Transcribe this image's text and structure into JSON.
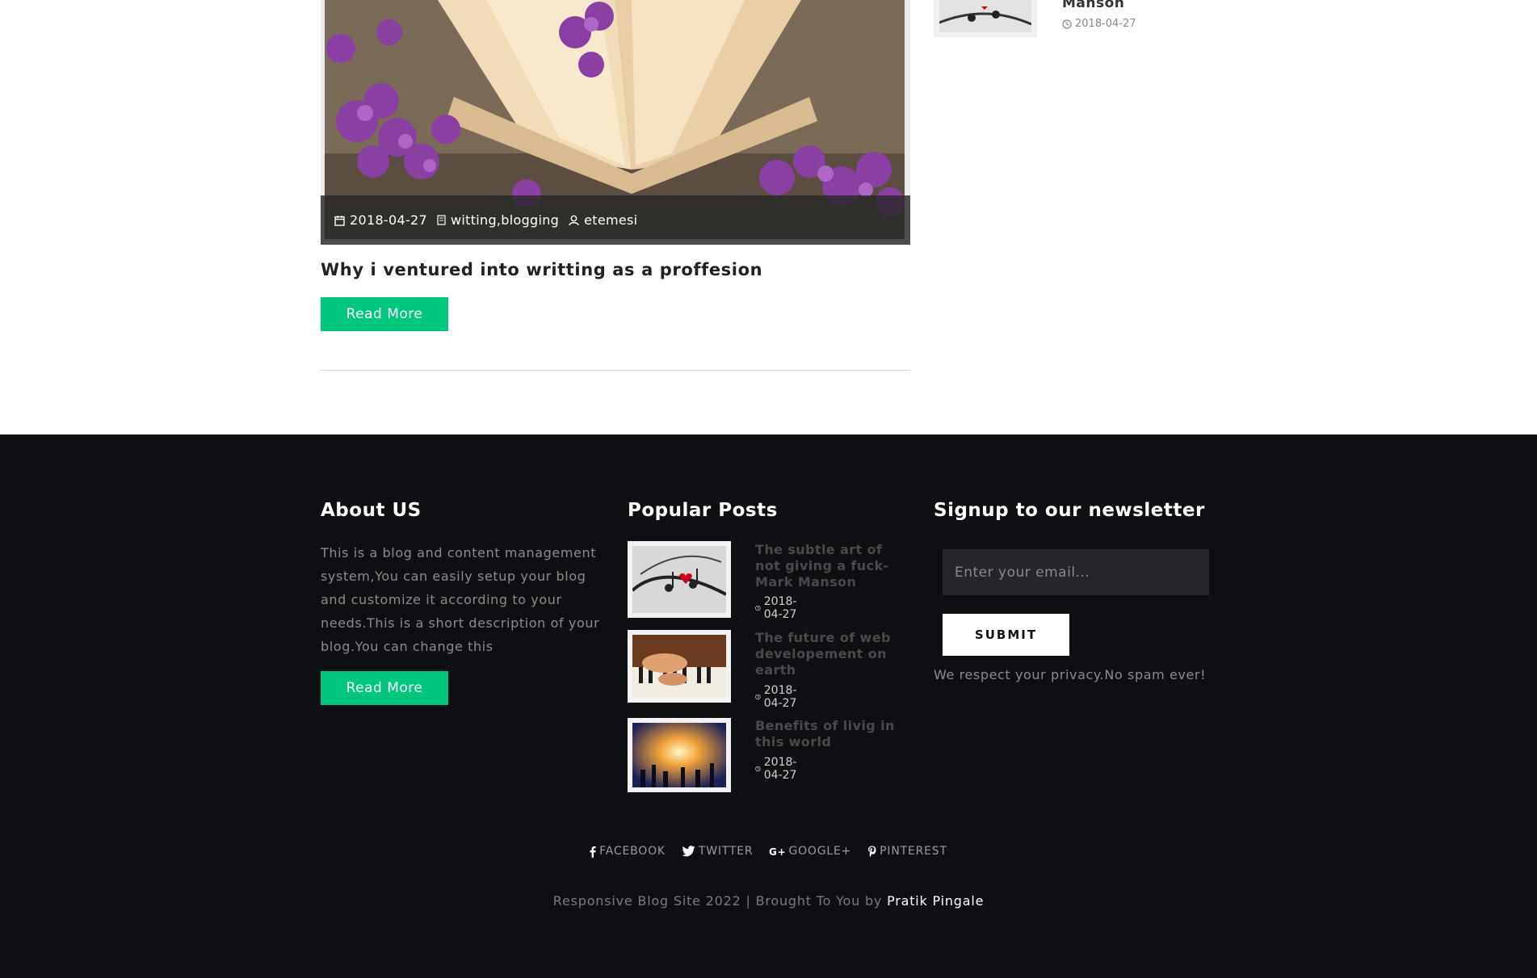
{
  "post": {
    "date": "2018-04-27",
    "tags": "witting,blogging",
    "author": "etemesi",
    "title": "Why i ventured into writting as a proffesion",
    "read_more": "Read More"
  },
  "sidebar_recent": {
    "title_fragment": "Manson",
    "date": "2018-04-27"
  },
  "footer": {
    "about": {
      "heading": "About US",
      "text": "This is a blog and content management system,You can easily setup your blog and customize it according to your needs.This is a short description of your blog.You can change this",
      "read_more": "Read More"
    },
    "popular": {
      "heading": "Popular Posts",
      "items": [
        {
          "title": "The subtle art of not giving a fuck-Mark Manson",
          "date": "2018-04-27",
          "icon": "music-notes-image"
        },
        {
          "title": "The future of web developement on earth",
          "date": "2018-04-27",
          "icon": "piano-image"
        },
        {
          "title": "Benefits of livig in this world",
          "date": "2018-04-27",
          "icon": "concert-image"
        }
      ]
    },
    "newsletter": {
      "heading": "Signup to our newsletter",
      "email_placeholder": "Enter your email...",
      "submit": "SUBMIT",
      "privacy": "We respect your privacy.No spam ever!"
    },
    "social": [
      {
        "label": "FACEBOOK",
        "icon": "facebook-icon"
      },
      {
        "label": "TWITTER",
        "icon": "twitter-icon"
      },
      {
        "label": "GOOGLE+",
        "icon": "google-plus-icon"
      },
      {
        "label": "PINTEREST",
        "icon": "pinterest-icon"
      }
    ],
    "copyright_text": "Responsive Blog Site 2022 | Brought To You by",
    "copyright_author": "Pratik Pingale"
  },
  "colors": {
    "accent": "#00c77d",
    "footer_bg": "#0f1013"
  }
}
